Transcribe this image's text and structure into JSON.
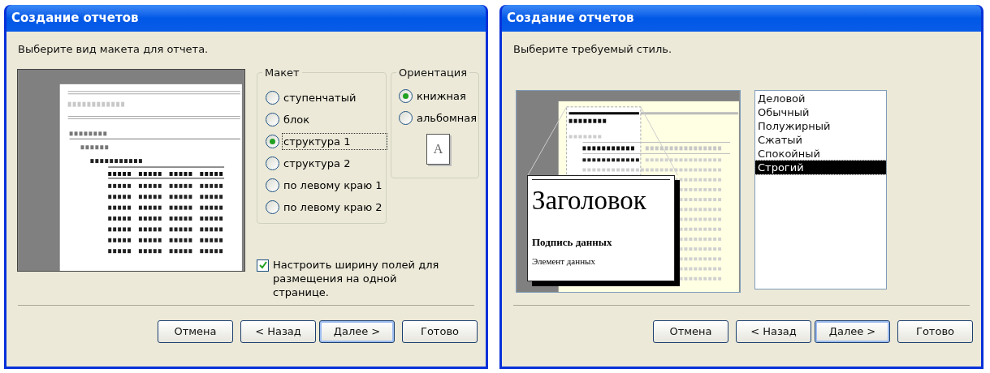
{
  "dialogs": [
    {
      "kind": "layout",
      "title": "Создание отчетов",
      "prompt": "Выберите вид макета для отчета.",
      "layout_group": {
        "label": "Макет",
        "options": [
          {
            "label": "ступенчатый",
            "selected": false
          },
          {
            "label": "блок",
            "selected": false
          },
          {
            "label": "структура 1",
            "selected": true
          },
          {
            "label": "структура 2",
            "selected": false
          },
          {
            "label": "по левому краю 1",
            "selected": false
          },
          {
            "label": "по левому краю 2",
            "selected": false
          }
        ]
      },
      "orientation_group": {
        "label": "Ориентация",
        "options": [
          {
            "label": "книжная",
            "selected": true
          },
          {
            "label": "альбомная",
            "selected": false
          }
        ],
        "page_letter": "A"
      },
      "fit_checkbox": {
        "label": "Настроить ширину полей для размещения на одной странице.",
        "checked": true
      },
      "buttons": [
        {
          "label": "Отмена",
          "default": false
        },
        {
          "label": "< Назад",
          "default": false
        },
        {
          "label": "Далее >",
          "default": true
        },
        {
          "label": "Готово",
          "default": false
        }
      ]
    },
    {
      "kind": "style",
      "title": "Создание отчетов",
      "prompt": "Выберите требуемый стиль.",
      "preview": {
        "heading": "Заголовок",
        "caption": "Подпись данных",
        "item": "Элемент данных"
      },
      "styles": [
        {
          "label": "Деловой",
          "selected": false
        },
        {
          "label": "Обычный",
          "selected": false
        },
        {
          "label": "Полужирный",
          "selected": false
        },
        {
          "label": "Сжатый",
          "selected": false
        },
        {
          "label": "Спокойный",
          "selected": false
        },
        {
          "label": "Строгий",
          "selected": true
        }
      ],
      "buttons": [
        {
          "label": "Отмена",
          "default": false
        },
        {
          "label": "< Назад",
          "default": false
        },
        {
          "label": "Далее >",
          "default": true
        },
        {
          "label": "Готово",
          "default": false
        }
      ]
    }
  ]
}
